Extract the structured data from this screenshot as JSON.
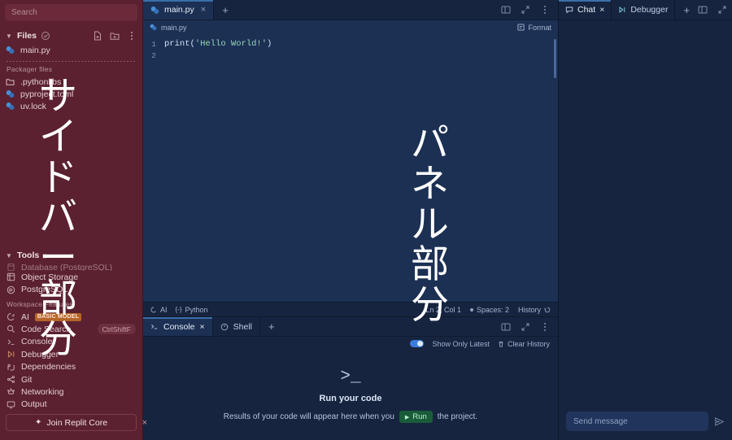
{
  "sidebar": {
    "search": {
      "placeholder": "Search"
    },
    "files": {
      "title": "Files",
      "icons": [
        "new-file-icon",
        "new-folder-icon",
        "more-icon"
      ],
      "items": [
        {
          "label": "main.py",
          "icon": "python-file-icon"
        }
      ]
    },
    "packager": {
      "label": "Packager files",
      "items": [
        {
          "label": ".pythonlibs",
          "icon": "folder-icon"
        },
        {
          "label": "pyproject.toml",
          "icon": "python-file-icon"
        },
        {
          "label": "uv.lock",
          "icon": "python-file-icon"
        }
      ]
    },
    "tools": {
      "title": "Tools",
      "clipped_item": "Database (PostgreSQL)",
      "items": [
        {
          "label": "Object Storage",
          "icon": "storage-icon"
        },
        {
          "label": "PostgreSQL",
          "icon": "postgres-icon"
        }
      ]
    },
    "workspace": {
      "label": "Workspace Features",
      "items": [
        {
          "label": "AI",
          "icon": "ai-icon",
          "badge": "BASIC MODEL"
        },
        {
          "label": "Code Search",
          "icon": "search-icon",
          "shortcut": "CtrlShiftF"
        },
        {
          "label": "Console",
          "icon": "console-icon"
        },
        {
          "label": "Debugger",
          "icon": "debugger-icon"
        },
        {
          "label": "Dependencies",
          "icon": "dependencies-icon"
        },
        {
          "label": "Git",
          "icon": "git-icon"
        },
        {
          "label": "Networking",
          "icon": "networking-icon"
        },
        {
          "label": "Output",
          "icon": "output-icon"
        }
      ]
    },
    "promo": {
      "label": "Join Replit Core",
      "icon": "sparkle-icon",
      "close": "×"
    }
  },
  "editor": {
    "tabs": [
      {
        "label": "main.py",
        "icon": "python-file-icon",
        "close": "×"
      }
    ],
    "add_tab": "+",
    "tools": [
      "split-pane-icon",
      "expand-icon",
      "more-icon"
    ],
    "breadcrumb": "main.py",
    "format_label": "Format",
    "code_lines": [
      {
        "num": "1",
        "prefix": "print(",
        "string": "'Hello World!'",
        "suffix": ")"
      },
      {
        "num": "2",
        "prefix": "",
        "string": "",
        "suffix": ""
      }
    ],
    "status": {
      "ai": "AI",
      "language": "Python",
      "cursor": "Ln 2, Col 1",
      "spaces": "Spaces: 2",
      "history": "History"
    }
  },
  "console": {
    "tabs": [
      {
        "label": "Console",
        "icon": "console-icon",
        "close": "×",
        "active": true
      },
      {
        "label": "Shell",
        "icon": "shell-icon",
        "active": false
      }
    ],
    "add_tab": "+",
    "tools": [
      "split-pane-icon",
      "expand-icon",
      "more-icon"
    ],
    "show_only_latest": "Show Only Latest",
    "clear_history": "Clear History",
    "empty": {
      "icon": ">_",
      "title": "Run your code",
      "text_before": "Results of your code will appear here when you",
      "run_label": "Run",
      "text_after": "the project."
    }
  },
  "right_panel": {
    "tabs": [
      {
        "label": "Chat",
        "icon": "chat-icon",
        "close": "×",
        "active": true
      },
      {
        "label": "Debugger",
        "icon": "debugger-icon",
        "active": false
      }
    ],
    "add_tab": "+",
    "tools": [
      "split-pane-icon",
      "expand-icon",
      "more-icon"
    ],
    "message_input": {
      "placeholder": "Send message"
    },
    "send_icon": "send-icon"
  },
  "overlay": {
    "sidebar_text": "サイドバー部分",
    "panel_text": "パネル部分"
  },
  "colors": {
    "sidebar_bg": "#5b2130",
    "editor_bg": "#1c3054",
    "panel_bg": "#16243f",
    "accent": "#3a6ea8",
    "badge": "#b5642a",
    "run": "#1a5c3a",
    "toggle_on": "#3b7ddd"
  }
}
